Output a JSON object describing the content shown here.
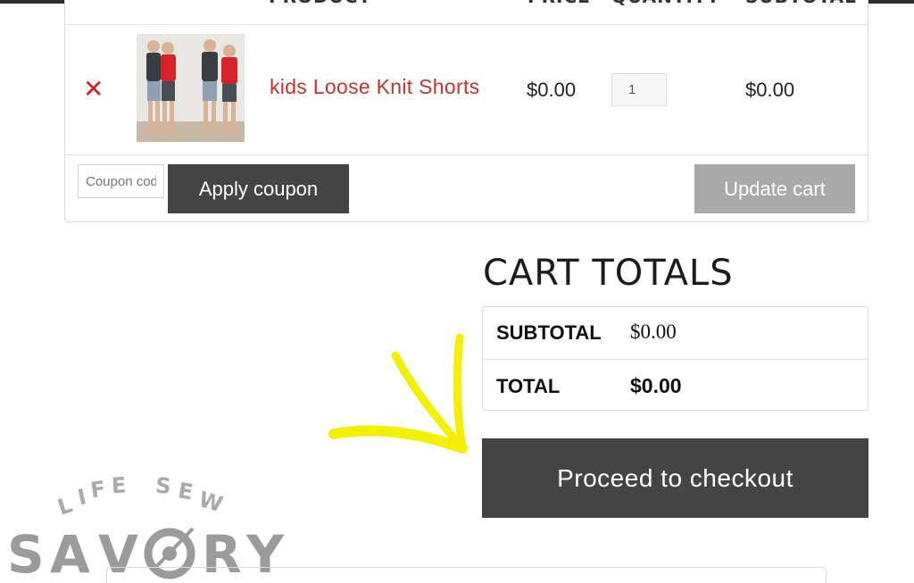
{
  "cart_table": {
    "headers": {
      "product": "PRODUCT",
      "price": "PRICE",
      "quantity": "QUANTITY",
      "subtotal": "SUBTOTAL"
    },
    "row": {
      "remove_symbol": "✕",
      "product_name": "kids Loose Knit Shorts",
      "price": "$0.00",
      "quantity": "1",
      "subtotal": "$0.00"
    },
    "coupon": {
      "placeholder": "Coupon code",
      "apply_label": "Apply coupon"
    },
    "update_label": "Update cart"
  },
  "cart_totals": {
    "title": "CART TOTALS",
    "subtotal_label": "SUBTOTAL",
    "subtotal_value": "$0.00",
    "total_label": "TOTAL",
    "total_value": "$0.00"
  },
  "checkout_label": "Proceed to checkout",
  "watermark": {
    "tagline": "LIFE SEW",
    "brand": "SAVORY"
  },
  "colors": {
    "accent_red": "#c9302c",
    "button_dark": "#444444",
    "button_gray": "#a9a9a9",
    "arrow_yellow": "#f4f000"
  },
  "icons": {
    "remove": "close-icon",
    "arrow": "hand-drawn-arrow-icon"
  }
}
